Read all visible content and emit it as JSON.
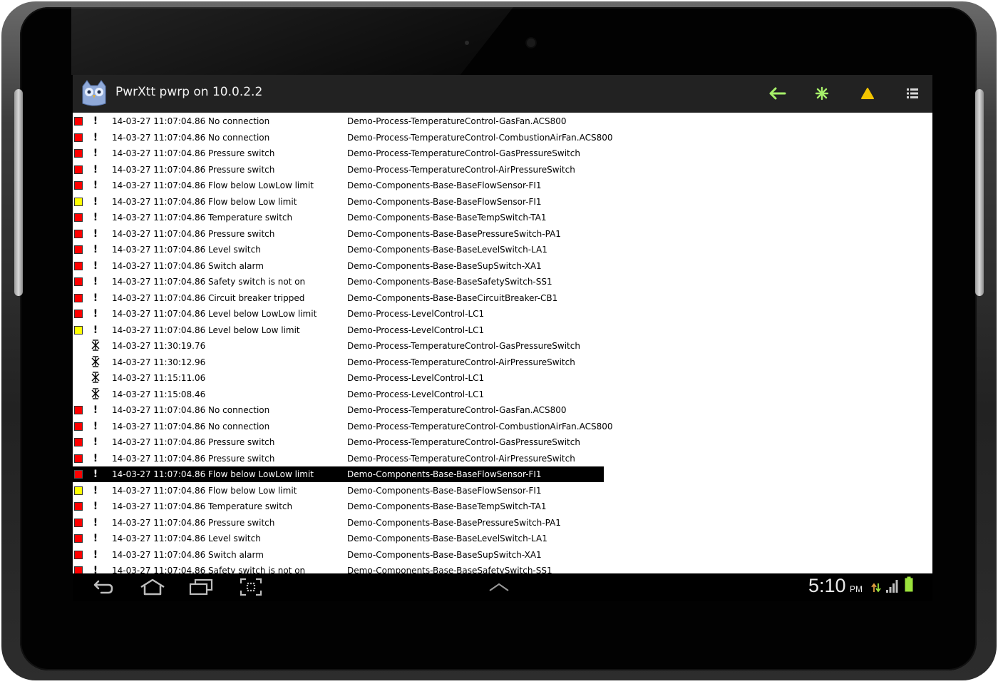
{
  "app": {
    "title": "PwrXtt pwrp on 10.0.2.2",
    "icon": "owl-app-icon",
    "actions": [
      {
        "name": "back-button",
        "icon": "arrow-left-icon",
        "color": "#a7f06a"
      },
      {
        "name": "events-button",
        "icon": "asterisk-icon",
        "color": "#a7f06a"
      },
      {
        "name": "alarm-button",
        "icon": "warning-triangle-icon",
        "color": "#f2c400"
      },
      {
        "name": "menu-button",
        "icon": "list-menu-icon",
        "color": "#d8d8d8"
      }
    ]
  },
  "colors": {
    "alarm_a": "#ff0000",
    "alarm_b": "#ffff00",
    "selected_row_bg": "#000000",
    "actionbar_bg": "#222222",
    "list_bg": "#ffffff"
  },
  "events": [
    {
      "prio": "A",
      "type": "alarm",
      "time": "14-03-27 11:07:04.86",
      "text": "No connection",
      "object": "Demo-Process-TemperatureControl-GasFan.ACS800"
    },
    {
      "prio": "A",
      "type": "alarm",
      "time": "14-03-27 11:07:04.86",
      "text": "No connection",
      "object": "Demo-Process-TemperatureControl-CombustionAirFan.ACS800"
    },
    {
      "prio": "A",
      "type": "alarm",
      "time": "14-03-27 11:07:04.86",
      "text": "Pressure switch",
      "object": "Demo-Process-TemperatureControl-GasPressureSwitch"
    },
    {
      "prio": "A",
      "type": "alarm",
      "time": "14-03-27 11:07:04.86",
      "text": "Pressure switch",
      "object": "Demo-Process-TemperatureControl-AirPressureSwitch"
    },
    {
      "prio": "A",
      "type": "alarm",
      "time": "14-03-27 11:07:04.86",
      "text": "Flow below LowLow limit",
      "object": "Demo-Components-Base-BaseFlowSensor-FI1"
    },
    {
      "prio": "B",
      "type": "alarm",
      "time": "14-03-27 11:07:04.86",
      "text": "Flow below Low limit",
      "object": "Demo-Components-Base-BaseFlowSensor-FI1"
    },
    {
      "prio": "A",
      "type": "alarm",
      "time": "14-03-27 11:07:04.86",
      "text": "Temperature switch",
      "object": "Demo-Components-Base-BaseTempSwitch-TA1"
    },
    {
      "prio": "A",
      "type": "alarm",
      "time": "14-03-27 11:07:04.86",
      "text": "Pressure switch",
      "object": "Demo-Components-Base-BasePressureSwitch-PA1"
    },
    {
      "prio": "A",
      "type": "alarm",
      "time": "14-03-27 11:07:04.86",
      "text": "Level switch",
      "object": "Demo-Components-Base-BaseLevelSwitch-LA1"
    },
    {
      "prio": "A",
      "type": "alarm",
      "time": "14-03-27 11:07:04.86",
      "text": "Switch alarm",
      "object": "Demo-Components-Base-BaseSupSwitch-XA1"
    },
    {
      "prio": "A",
      "type": "alarm",
      "time": "14-03-27 11:07:04.86",
      "text": "Safety switch is not on",
      "object": "Demo-Components-Base-BaseSafetySwitch-SS1"
    },
    {
      "prio": "A",
      "type": "alarm",
      "time": "14-03-27 11:07:04.86",
      "text": "Circuit breaker tripped",
      "object": "Demo-Components-Base-BaseCircuitBreaker-CB1"
    },
    {
      "prio": "A",
      "type": "alarm",
      "time": "14-03-27 11:07:04.86",
      "text": "Level below LowLow limit",
      "object": "Demo-Process-LevelControl-LC1"
    },
    {
      "prio": "B",
      "type": "alarm",
      "time": "14-03-27 11:07:04.86",
      "text": "Level below Low limit",
      "object": "Demo-Process-LevelControl-LC1"
    },
    {
      "prio": "",
      "type": "block",
      "time": "14-03-27 11:30:19.76",
      "text": "",
      "object": "Demo-Process-TemperatureControl-GasPressureSwitch"
    },
    {
      "prio": "",
      "type": "block",
      "time": "14-03-27 11:30:12.96",
      "text": "",
      "object": "Demo-Process-TemperatureControl-AirPressureSwitch"
    },
    {
      "prio": "",
      "type": "block",
      "time": "14-03-27 11:15:11.06",
      "text": "",
      "object": "Demo-Process-LevelControl-LC1"
    },
    {
      "prio": "",
      "type": "block",
      "time": "14-03-27 11:15:08.46",
      "text": "",
      "object": "Demo-Process-LevelControl-LC1"
    },
    {
      "prio": "A",
      "type": "alarm",
      "time": "14-03-27 11:07:04.86",
      "text": "No connection",
      "object": "Demo-Process-TemperatureControl-GasFan.ACS800"
    },
    {
      "prio": "A",
      "type": "alarm",
      "time": "14-03-27 11:07:04.86",
      "text": "No connection",
      "object": "Demo-Process-TemperatureControl-CombustionAirFan.ACS800"
    },
    {
      "prio": "A",
      "type": "alarm",
      "time": "14-03-27 11:07:04.86",
      "text": "Pressure switch",
      "object": "Demo-Process-TemperatureControl-GasPressureSwitch"
    },
    {
      "prio": "A",
      "type": "alarm",
      "time": "14-03-27 11:07:04.86",
      "text": "Pressure switch",
      "object": "Demo-Process-TemperatureControl-AirPressureSwitch"
    },
    {
      "prio": "A",
      "type": "alarm",
      "time": "14-03-27 11:07:04.86",
      "text": "Flow below LowLow limit",
      "object": "Demo-Components-Base-BaseFlowSensor-FI1",
      "selected": true
    },
    {
      "prio": "B",
      "type": "alarm",
      "time": "14-03-27 11:07:04.86",
      "text": "Flow below Low limit",
      "object": "Demo-Components-Base-BaseFlowSensor-FI1"
    },
    {
      "prio": "A",
      "type": "alarm",
      "time": "14-03-27 11:07:04.86",
      "text": "Temperature switch",
      "object": "Demo-Components-Base-BaseTempSwitch-TA1"
    },
    {
      "prio": "A",
      "type": "alarm",
      "time": "14-03-27 11:07:04.86",
      "text": "Pressure switch",
      "object": "Demo-Components-Base-BasePressureSwitch-PA1"
    },
    {
      "prio": "A",
      "type": "alarm",
      "time": "14-03-27 11:07:04.86",
      "text": "Level switch",
      "object": "Demo-Components-Base-BaseLevelSwitch-LA1"
    },
    {
      "prio": "A",
      "type": "alarm",
      "time": "14-03-27 11:07:04.86",
      "text": "Switch alarm",
      "object": "Demo-Components-Base-BaseSupSwitch-XA1"
    },
    {
      "prio": "A",
      "type": "alarm",
      "time": "14-03-27 11:07:04.86",
      "text": "Safety switch is not on",
      "object": "Demo-Components-Base-BaseSafetySwitch-SS1"
    }
  ],
  "navbar": {
    "buttons": [
      "back-nav-icon",
      "home-nav-icon",
      "recent-apps-icon",
      "screenshot-icon"
    ],
    "center": "chevron-up-icon"
  },
  "status": {
    "time": "5:10",
    "ampm": "PM",
    "icons": [
      "data-transfer-icon",
      "signal-icon",
      "battery-icon"
    ],
    "battery_color": "#9be23c"
  }
}
